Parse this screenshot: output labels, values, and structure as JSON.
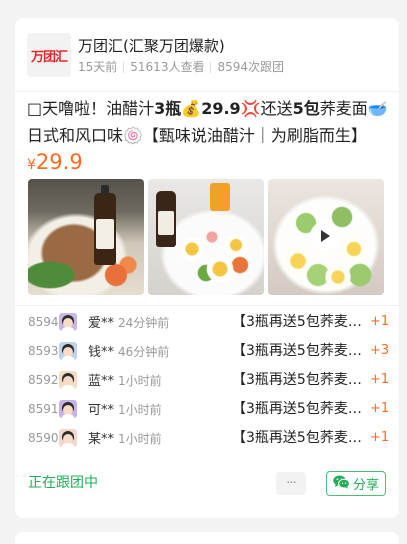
{
  "theme": {
    "accent_orange": "#ff6b22",
    "accent_green": "#1fae56",
    "logo_red": "#e3262e"
  },
  "group": {
    "logo_text": "万团汇",
    "name": "万团汇(汇聚万团爆款)",
    "time_ago": "15天前",
    "views": "51613人查看",
    "joins": "8594次跟团"
  },
  "post": {
    "headline_segments": [
      "□天噜啦！油醋汁",
      "3瓶",
      "💰",
      "29.9",
      "💢还送",
      "5包",
      "荞麦面🥣日式和风口味🍥【甄味说油醋汁｜为刷脂而生】沙…"
    ],
    "price_symbol": "¥",
    "price": "29.9",
    "media": [
      {
        "type": "image"
      },
      {
        "type": "image"
      },
      {
        "type": "video",
        "icon": "play-icon"
      }
    ]
  },
  "rows": [
    {
      "no": "8594",
      "name": "爱**",
      "time": "24分钟前",
      "product": "【3瓶再送5包荞麦…",
      "qty": "+1",
      "avatar_bg": "#c9b7e6"
    },
    {
      "no": "8593",
      "name": "钱**",
      "time": "46分钟前",
      "product": "【3瓶再送5包荞麦…",
      "qty": "+3",
      "avatar_bg": "#bcd3ea"
    },
    {
      "no": "8592",
      "name": "蓝**",
      "time": "1小时前",
      "product": "【3瓶再送5包荞麦…",
      "qty": "+1",
      "avatar_bg": "#f1dcc4"
    },
    {
      "no": "8591",
      "name": "可**",
      "time": "1小时前",
      "product": "【3瓶再送5包荞麦…",
      "qty": "+1",
      "avatar_bg": "#c7b3e8"
    },
    {
      "no": "8590",
      "name": "某**",
      "time": "1小时前",
      "product": "【3瓶再送5包荞麦…",
      "qty": "+1",
      "avatar_bg": "#f2d6d0"
    }
  ],
  "footer": {
    "status": "正在跟团中",
    "more_icon": "more-dots-icon",
    "more_label": "···",
    "share_icon": "wechat-icon",
    "share_label": "分享"
  }
}
